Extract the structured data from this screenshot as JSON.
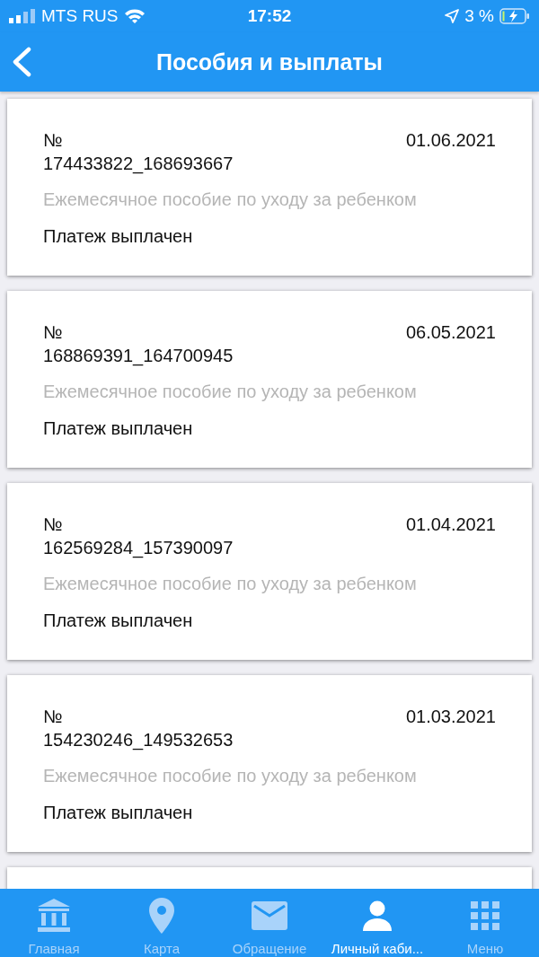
{
  "status_bar": {
    "carrier": "MTS RUS",
    "time": "17:52",
    "battery": "3 %"
  },
  "header": {
    "title": "Пособия и выплаты"
  },
  "payments": [
    {
      "number": "№\n174433822_168693667",
      "date": "01.06.2021",
      "type": "Ежемесячное пособие по уходу за ребенком",
      "status": "Платеж выплачен"
    },
    {
      "number": "№\n168869391_164700945",
      "date": "06.05.2021",
      "type": "Ежемесячное пособие по уходу за ребенком",
      "status": "Платеж выплачен"
    },
    {
      "number": "№\n162569284_157390097",
      "date": "01.04.2021",
      "type": "Ежемесячное пособие по уходу за ребенком",
      "status": "Платеж выплачен"
    },
    {
      "number": "№\n154230246_149532653",
      "date": "01.03.2021",
      "type": "Ежемесячное пособие по уходу за ребенком",
      "status": "Платеж выплачен"
    }
  ],
  "tab_bar": [
    {
      "label": "Главная",
      "kind": "bank",
      "selected": false
    },
    {
      "label": "Карта",
      "kind": "pin",
      "selected": false
    },
    {
      "label": "Обращение",
      "kind": "mail",
      "selected": false
    },
    {
      "label": "Личный каби...",
      "kind": "person",
      "selected": true
    },
    {
      "label": "Меню",
      "kind": "grid",
      "selected": false
    }
  ]
}
